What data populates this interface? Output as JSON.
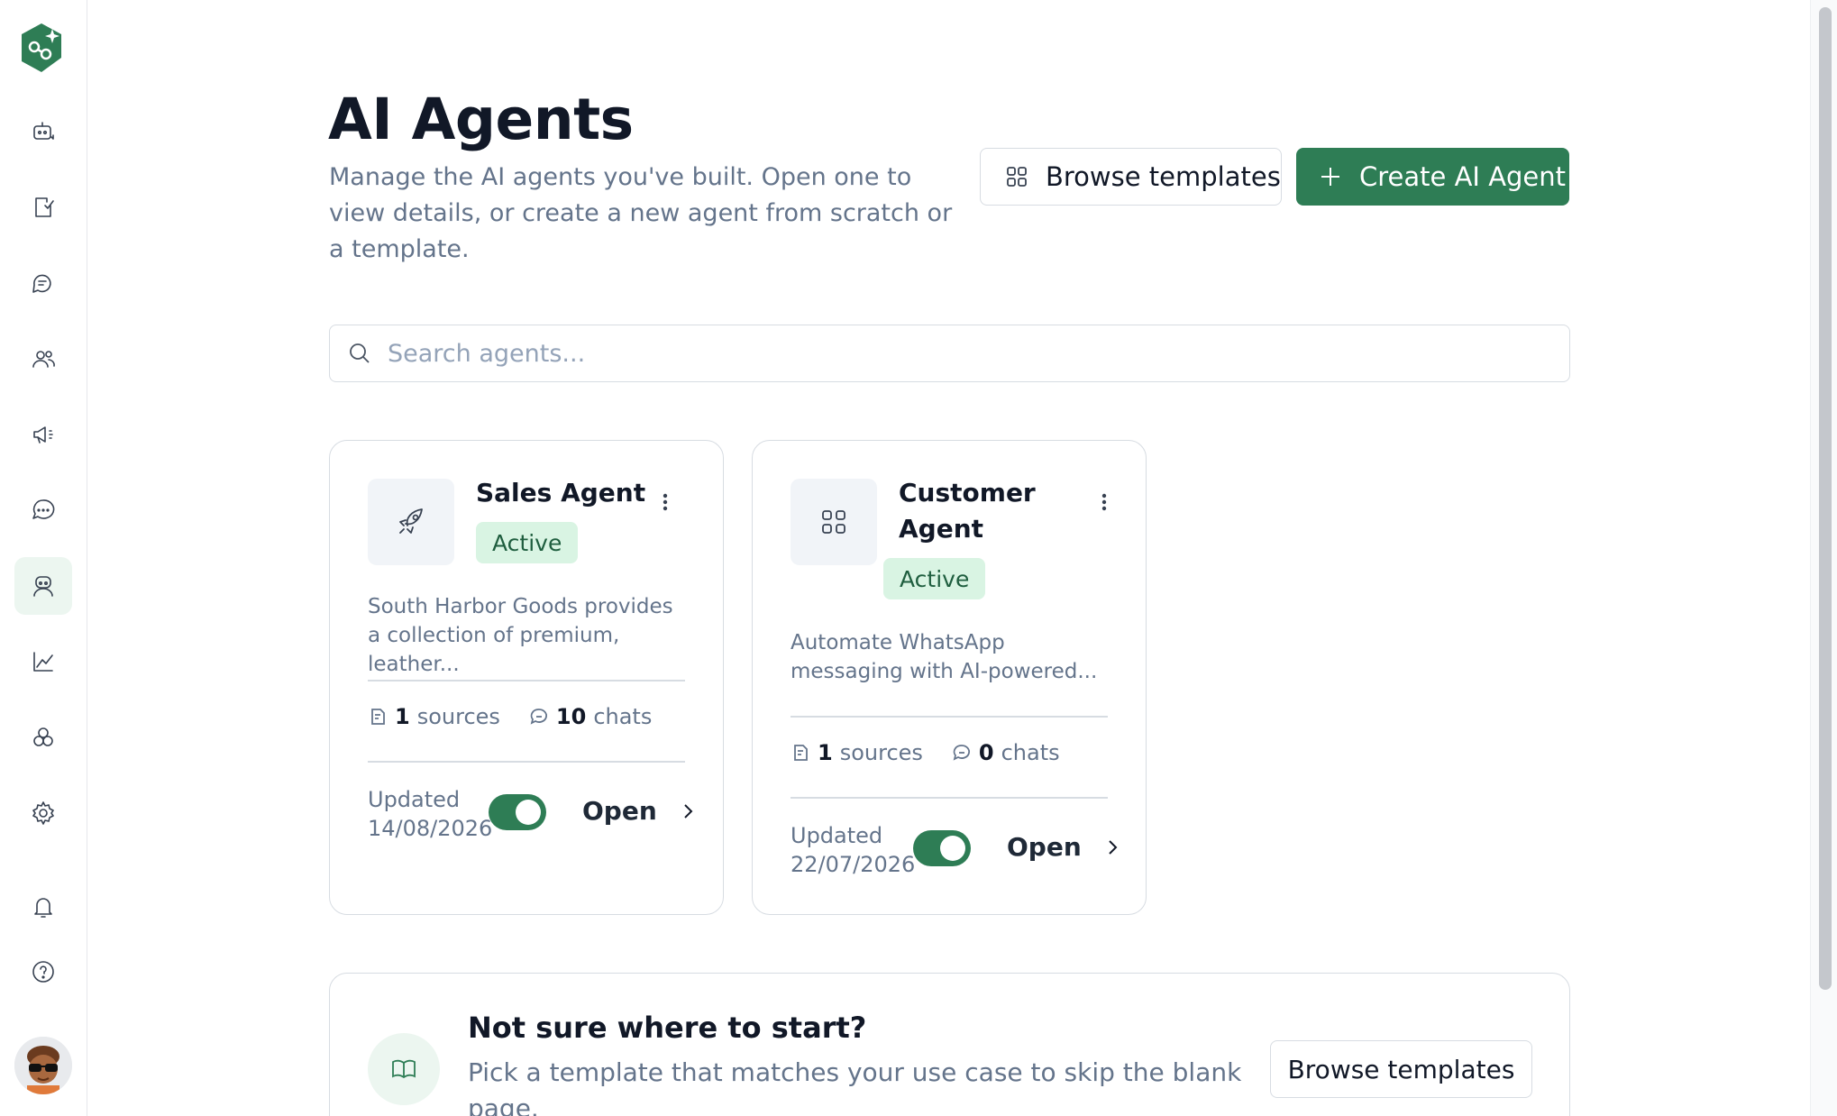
{
  "header": {
    "title": "AI Agents",
    "description": "Manage the AI agents you've built. Open one to view details, or create a new agent from scratch or a template.",
    "browse_templates_label": "Browse templates",
    "create_label": "Create AI Agent"
  },
  "search": {
    "placeholder": "Search agents...",
    "value": ""
  },
  "agents": [
    {
      "name": "Sales Agent",
      "status": "Active",
      "icon": "rocket-icon",
      "description": "South Harbor Goods provides a collection of premium, leather...",
      "sources_count": "1",
      "sources_label": "sources",
      "chats_count": "10",
      "chats_label": "chats",
      "updated_label": "Updated",
      "updated_date": "14/08/2026",
      "enabled": true,
      "open_label": "Open"
    },
    {
      "name": "Customer Agent",
      "status": "Active",
      "icon": "grid-icon",
      "description": "Automate WhatsApp messaging with AI-powered...",
      "sources_count": "1",
      "sources_label": "sources",
      "chats_count": "0",
      "chats_label": "chats",
      "updated_label": "Updated",
      "updated_date": "22/07/2026",
      "enabled": true,
      "open_label": "Open"
    }
  ],
  "banner": {
    "title": "Not sure where to start?",
    "text": "Pick a template that matches your use case to skip the blank page.",
    "button_label": "Browse templates"
  },
  "sidebar": {
    "items": [
      {
        "icon": "bot-sparkle-icon"
      },
      {
        "icon": "tasks-icon"
      },
      {
        "icon": "conversations-icon"
      },
      {
        "icon": "contacts-icon"
      },
      {
        "icon": "campaigns-icon"
      },
      {
        "icon": "chat-icon"
      },
      {
        "icon": "ai-agents-icon",
        "active": true
      },
      {
        "icon": "analytics-icon"
      },
      {
        "icon": "integrations-icon"
      },
      {
        "icon": "settings-icon"
      },
      {
        "icon": "notifications-icon"
      },
      {
        "icon": "help-icon"
      }
    ]
  },
  "colors": {
    "brand": "#2e7d55",
    "badge_bg": "#d9f4e3",
    "active_nav_bg": "#ecf6f0"
  }
}
